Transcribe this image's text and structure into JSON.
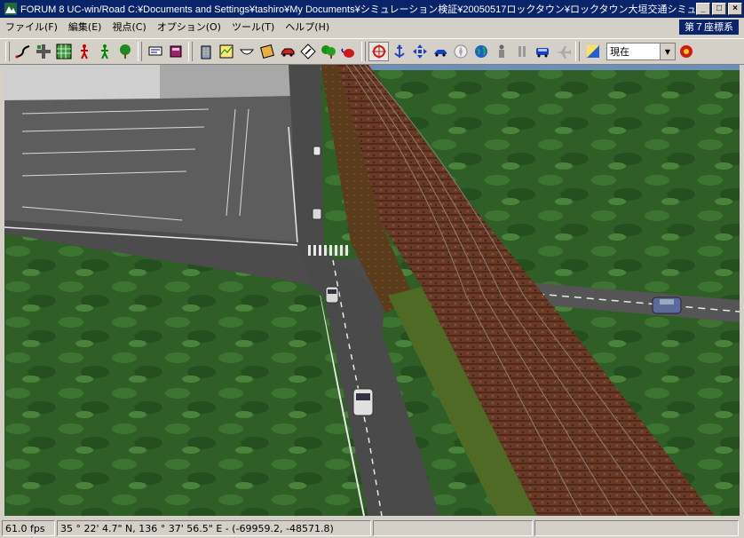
{
  "window": {
    "title": "FORUM 8    UC-win/Road    C:¥Documents and Settings¥tashiro¥My Documents¥シミュレーション検証¥20050517ロックタウン¥ロックタウン大垣交通シミュ...",
    "app_icon": "forum8-logo-icon",
    "minimize_label": "_",
    "maximize_label": "□",
    "close_label": "×"
  },
  "menu": {
    "items": [
      {
        "label": "ファイル(F)"
      },
      {
        "label": "編集(E)"
      },
      {
        "label": "視点(C)"
      },
      {
        "label": "オプション(O)"
      },
      {
        "label": "ツール(T)"
      },
      {
        "label": "ヘルプ(H)"
      }
    ],
    "coordinate_system": "第７座標系"
  },
  "toolbar": {
    "buttons": [
      {
        "icon": "road-alignment-icon"
      },
      {
        "icon": "intersection-icon"
      },
      {
        "icon": "grid-terrain-icon"
      },
      {
        "icon": "pedestrian-red-icon"
      },
      {
        "icon": "pedestrian-green-icon"
      },
      {
        "icon": "tree-icon"
      },
      {
        "icon": "signboard-icon"
      },
      {
        "icon": "book-icon"
      },
      {
        "icon": "building-icon"
      },
      {
        "icon": "map-icon"
      },
      {
        "icon": "bowl-icon"
      },
      {
        "icon": "scroll-icon"
      },
      {
        "icon": "car-icon"
      },
      {
        "icon": "traffic-sign-icon"
      },
      {
        "icon": "forest-icon"
      },
      {
        "icon": "teapot-icon"
      },
      {
        "icon": "target-view-icon"
      },
      {
        "icon": "anchor-icon"
      },
      {
        "icon": "move-arrows-icon"
      },
      {
        "icon": "drive-car-icon"
      },
      {
        "icon": "compass-icon"
      },
      {
        "icon": "globe-icon"
      },
      {
        "icon": "person-icon"
      },
      {
        "icon": "pause-icon"
      },
      {
        "icon": "bus-icon"
      },
      {
        "icon": "plane-icon"
      },
      {
        "icon": "sun-sky-icon"
      },
      {
        "icon": "traffic-light-icon"
      }
    ],
    "view_select": {
      "value": "現在"
    }
  },
  "viewport": {
    "description_icon": "3d-scene"
  },
  "status": {
    "fps": "61.0 fps",
    "position": "35 °   22' 4.7\" N, 136 °   37' 56.5\" E  -  (-69959.2, -48571.8)",
    "pane3": "",
    "pane4": ""
  }
}
